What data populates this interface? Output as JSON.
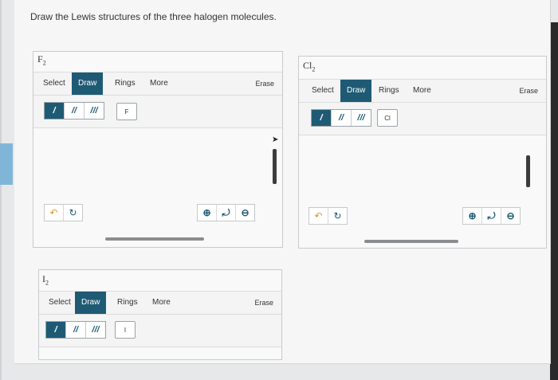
{
  "question": "Draw the Lewis structures of the three halogen molecules.",
  "editors": [
    {
      "title": "F",
      "subscript": "2",
      "tabs": {
        "select": "Select",
        "draw": "Draw",
        "rings": "Rings",
        "more": "More"
      },
      "erase": "Erase",
      "atom": "F",
      "bonds": [
        "/",
        "//",
        "///"
      ],
      "undo": "↶",
      "redo": "↻",
      "zoom_in": "⊕",
      "reset": "⤾",
      "zoom_out": "⊖"
    },
    {
      "title": "Cl",
      "subscript": "2",
      "tabs": {
        "select": "Select",
        "draw": "Draw",
        "rings": "Rings",
        "more": "More"
      },
      "erase": "Erase",
      "atom": "Cl",
      "bonds": [
        "/",
        "//",
        "///"
      ],
      "undo": "↶",
      "redo": "↻",
      "zoom_in": "⊕",
      "reset": "⤾",
      "zoom_out": "⊖"
    },
    {
      "title": "I",
      "subscript": "2",
      "tabs": {
        "select": "Select",
        "draw": "Draw",
        "rings": "Rings",
        "more": "More"
      },
      "erase": "Erase",
      "atom": "I",
      "bonds": [
        "/",
        "//",
        "///"
      ]
    }
  ],
  "colors": {
    "accent": "#1f5a74",
    "undo": "#e0962a"
  }
}
